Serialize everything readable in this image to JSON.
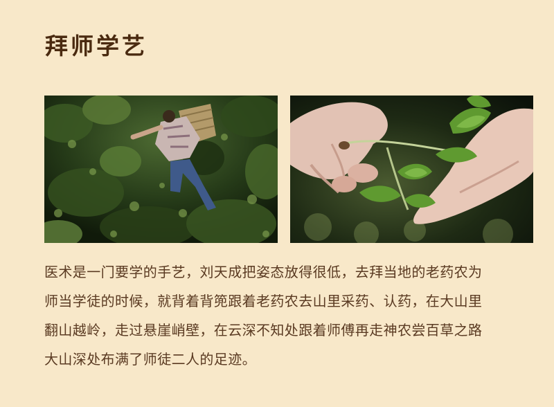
{
  "heading": "拜师学艺",
  "images": [
    {
      "name": "photo-herb-gatherer-in-brush",
      "alt": ""
    },
    {
      "name": "photo-hands-holding-herb",
      "alt": ""
    }
  ],
  "paragraph_lines": [
    "医术是一门要学的手艺，刘天成把姿态放得很低，去拜当地的老药农为",
    "师当学徒的时候，就背着背篼跟着老药农去山里采药、认药，在大山里",
    "翻山越岭，走过悬崖峭壁，在云深不知处跟着师傅再走神农尝百草之路",
    "大山深处布满了师徒二人的足迹。"
  ]
}
